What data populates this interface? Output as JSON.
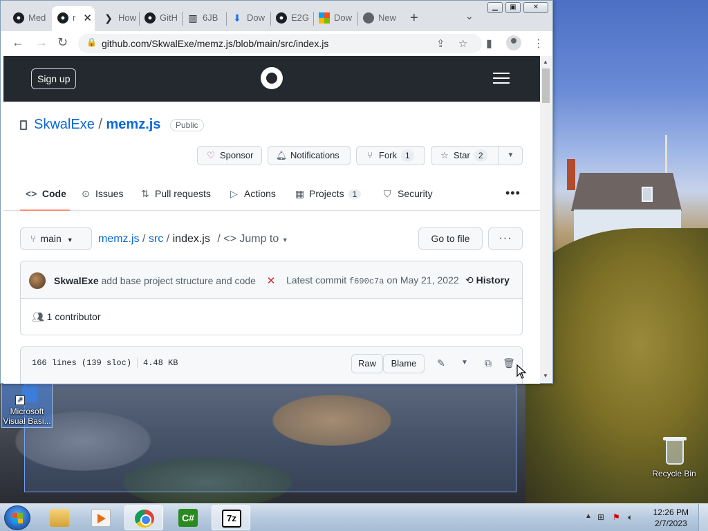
{
  "browser": {
    "tabs": [
      {
        "label": "Med",
        "icon": "github-icon"
      },
      {
        "label": "r",
        "icon": "github-icon",
        "active": true
      },
      {
        "label": "How",
        "icon": "bookmark-icon"
      },
      {
        "label": "GitH",
        "icon": "github-icon"
      },
      {
        "label": "6JB",
        "icon": "archive-icon"
      },
      {
        "label": "Dow",
        "icon": "download-icon"
      },
      {
        "label": "E2G",
        "icon": "github-icon"
      },
      {
        "label": "Dow",
        "icon": "microsoft-icon"
      },
      {
        "label": "New",
        "icon": "chrome-icon"
      }
    ],
    "new_tab_symbol": "+",
    "url": "github.com/SkwalExe/memz.js/blob/main/src/index.js"
  },
  "github": {
    "signup_label": "Sign up",
    "repo_owner": "SkwalExe",
    "repo_sep": "/",
    "repo_name": "memz.js",
    "visibility": "Public",
    "actions": {
      "sponsor": "Sponsor",
      "notifications": "Notifications",
      "fork": "Fork",
      "fork_count": "1",
      "star": "Star",
      "star_count": "2"
    },
    "nav": {
      "code": "Code",
      "issues": "Issues",
      "pull_requests": "Pull requests",
      "actions": "Actions",
      "projects": "Projects",
      "projects_count": "1",
      "security": "Security"
    },
    "branch": "main",
    "breadcrumb": {
      "root": "memz.js",
      "sep1": "/",
      "dir": "src",
      "sep2": "/",
      "file": "index.js",
      "sep3": "/"
    },
    "jump_to": "Jump to",
    "go_to_file": "Go to file",
    "commit": {
      "author": "SkwalExe",
      "message": "add base project structure and code",
      "status": "✕",
      "latest_label": "Latest commit",
      "sha": "f690c7a",
      "date_prefix": "on",
      "date": "May 21, 2022",
      "history": "History"
    },
    "contributors": "1 contributor",
    "file": {
      "lines": "166 lines (139 sloc)",
      "size": "4.48 KB",
      "raw": "Raw",
      "blame": "Blame"
    }
  },
  "desktop": {
    "vb_icon_label": "Microsoft Visual Basi...",
    "recycle_bin_label": "Recycle Bin"
  },
  "taskbar": {
    "time": "12:26 PM",
    "date": "2/7/2023",
    "csharp_label": "C#",
    "sevenzip_label": "7z"
  }
}
